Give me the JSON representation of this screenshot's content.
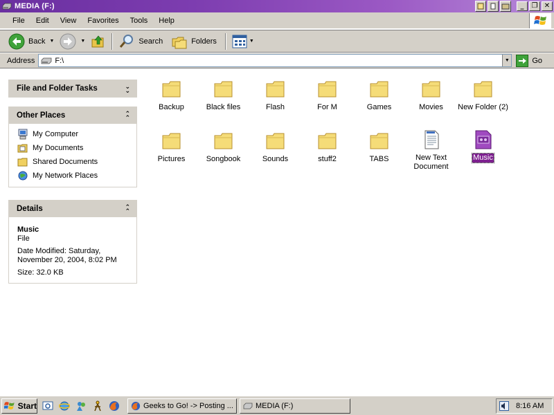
{
  "window": {
    "title": "MEDIA (F:)",
    "accent": "#7d3db0",
    "controls": {
      "minimize": "_",
      "restore": "❐",
      "close": "✕"
    }
  },
  "menubar": {
    "items": [
      "File",
      "Edit",
      "View",
      "Favorites",
      "Tools",
      "Help"
    ]
  },
  "toolbar": {
    "back_label": "Back",
    "search_label": "Search",
    "folders_label": "Folders"
  },
  "address": {
    "label": "Address",
    "value": "F:\\",
    "go_label": "Go"
  },
  "sidebar": {
    "tasks": {
      "title": "File and Folder Tasks",
      "chevron": "collapsed"
    },
    "other_places": {
      "title": "Other Places",
      "items": [
        {
          "label": "My Computer",
          "icon": "my-computer-icon"
        },
        {
          "label": "My Documents",
          "icon": "my-documents-icon"
        },
        {
          "label": "Shared Documents",
          "icon": "folder-icon"
        },
        {
          "label": "My Network Places",
          "icon": "network-places-icon"
        }
      ]
    },
    "details": {
      "title": "Details",
      "name": "Music",
      "type": "File",
      "date_modified": "Date Modified: Saturday, November 20, 2004, 8:02 PM",
      "size": "Size: 32.0 KB"
    }
  },
  "files": [
    {
      "name": "Backup",
      "icon": "folder-icon"
    },
    {
      "name": "Black files",
      "icon": "folder-icon"
    },
    {
      "name": "Flash",
      "icon": "folder-icon"
    },
    {
      "name": "For M",
      "icon": "folder-icon"
    },
    {
      "name": "Games",
      "icon": "folder-icon"
    },
    {
      "name": "Movies",
      "icon": "folder-icon"
    },
    {
      "name": "New Folder (2)",
      "icon": "folder-icon"
    },
    {
      "name": "Pictures",
      "icon": "folder-icon"
    },
    {
      "name": "Songbook",
      "icon": "folder-icon"
    },
    {
      "name": "Sounds",
      "icon": "folder-icon"
    },
    {
      "name": "stuff2",
      "icon": "folder-icon"
    },
    {
      "name": "TABS",
      "icon": "folder-icon"
    },
    {
      "name": "New Text Document",
      "icon": "text-document-icon"
    },
    {
      "name": "Music",
      "icon": "media-file-icon",
      "selected": true
    }
  ],
  "taskbar": {
    "start_label": "Start",
    "tasks": [
      {
        "label": "Geeks to Go! -> Posting ...",
        "icon": "firefox-icon"
      },
      {
        "label": "MEDIA (F:)",
        "icon": "drive-icon"
      }
    ],
    "clock": "8:16 AM"
  }
}
